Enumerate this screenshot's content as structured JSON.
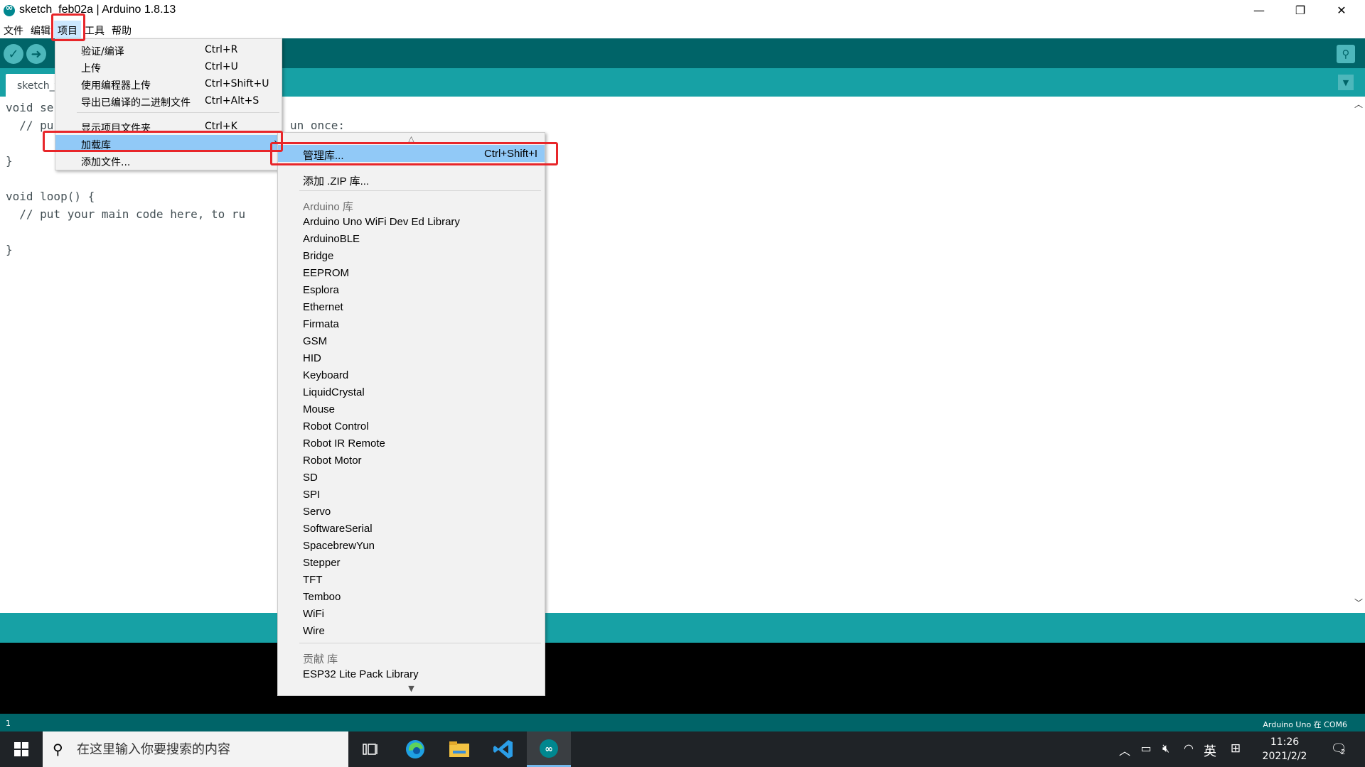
{
  "window": {
    "title": "sketch_feb02a | Arduino 1.8.13",
    "minimize": "—",
    "maximize": "❐",
    "close": "✕"
  },
  "menubar": [
    "文件",
    "编辑",
    "项目",
    "工具",
    "帮助"
  ],
  "toolbar": {
    "verify_icon": "check-icon",
    "upload_icon": "arrow-right-icon",
    "serial_monitor_icon": "magnifier-icon"
  },
  "tab": {
    "label": "sketch_f"
  },
  "editor": {
    "lines": [
      "void se",
      "  // pu",
      "}",
      "void loop() {",
      "  // put your main code here, to ru",
      "}"
    ],
    "hidden_fragment": "un once:"
  },
  "project_menu": {
    "items": [
      {
        "label": "验证/编译",
        "shortcut": "Ctrl+R"
      },
      {
        "label": "上传",
        "shortcut": "Ctrl+U"
      },
      {
        "label": "使用编程器上传",
        "shortcut": "Ctrl+Shift+U"
      },
      {
        "label": "导出已编译的二进制文件",
        "shortcut": "Ctrl+Alt+S"
      },
      {
        "label": "显示项目文件夹",
        "shortcut": "Ctrl+K"
      },
      {
        "label": "加载库",
        "shortcut": ""
      },
      {
        "label": "添加文件...",
        "shortcut": ""
      }
    ],
    "highlighted": "加载库"
  },
  "library_menu": {
    "manage": {
      "label": "管理库...",
      "shortcut": "Ctrl+Shift+I"
    },
    "add_zip": "添加 .ZIP 库...",
    "arduino_header": "Arduino 库",
    "arduino_libs": [
      "Arduino Uno WiFi Dev Ed Library",
      "ArduinoBLE",
      "Bridge",
      "EEPROM",
      "Esplora",
      "Ethernet",
      "Firmata",
      "GSM",
      "HID",
      "Keyboard",
      "LiquidCrystal",
      "Mouse",
      "Robot Control",
      "Robot IR Remote",
      "Robot Motor",
      "SD",
      "SPI",
      "Servo",
      "SoftwareSerial",
      "SpacebrewYun",
      "Stepper",
      "TFT",
      "Temboo",
      "WiFi",
      "Wire"
    ],
    "contrib_header": "贡献 库",
    "contrib_libs": [
      "ESP32 Lite Pack Library"
    ],
    "scroll_up": "△",
    "scroll_down": "▼"
  },
  "statusbar": {
    "line": "1",
    "board": "Arduino Uno 在 COM6"
  },
  "taskbar": {
    "search_placeholder": "在这里输入你要搜索的内容",
    "time": "11:26",
    "date": "2021/2/2",
    "ime_lang": "英",
    "notification_count": "2"
  },
  "colors": {
    "toolbar": "#006468",
    "tabstrip": "#17a1a5",
    "highlight": "#91c9f7",
    "annotation": "#e8262a"
  }
}
